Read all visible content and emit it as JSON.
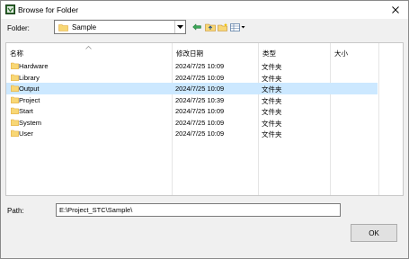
{
  "window": {
    "title": "Browse for Folder"
  },
  "toolbar": {
    "folder_label": "Folder:",
    "folder_value": "Sample"
  },
  "list": {
    "columns": [
      "名称",
      "修改日期",
      "类型",
      "大小"
    ],
    "rows": [
      {
        "name": "Hardware",
        "modified": "2024/7/25 10:09",
        "type": "文件夹",
        "size": "",
        "selected": false
      },
      {
        "name": "Library",
        "modified": "2024/7/25 10:09",
        "type": "文件夹",
        "size": "",
        "selected": false
      },
      {
        "name": "Output",
        "modified": "2024/7/25 10:09",
        "type": "文件夹",
        "size": "",
        "selected": true
      },
      {
        "name": "Project",
        "modified": "2024/7/25 10:39",
        "type": "文件夹",
        "size": "",
        "selected": false
      },
      {
        "name": "Start",
        "modified": "2024/7/25 10:09",
        "type": "文件夹",
        "size": "",
        "selected": false
      },
      {
        "name": "System",
        "modified": "2024/7/25 10:09",
        "type": "文件夹",
        "size": "",
        "selected": false
      },
      {
        "name": "User",
        "modified": "2024/7/25 10:09",
        "type": "文件夹",
        "size": "",
        "selected": false
      }
    ]
  },
  "path": {
    "label": "Path:",
    "value": "E:\\Project_STC\\Sample\\"
  },
  "buttons": {
    "ok": "OK"
  },
  "icons": {
    "folder": "folder-icon",
    "back": "back-arrow-icon",
    "up": "up-folder-icon",
    "new_folder": "new-folder-icon",
    "view_menu": "view-menu-icon",
    "close": "close-icon"
  },
  "colors": {
    "selection": "#cce8ff",
    "folder_yellow": "#f8d775",
    "folder_dark": "#e0a83a"
  }
}
